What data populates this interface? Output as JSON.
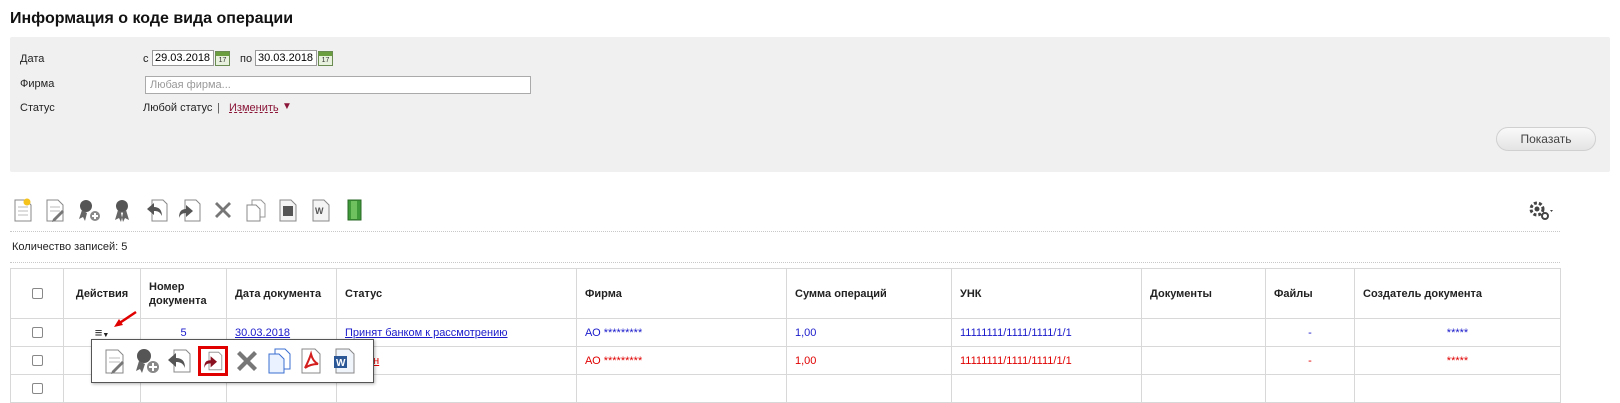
{
  "page": {
    "title": "Информация о коде вида операции"
  },
  "filters": {
    "date_label": "Дата",
    "date_from_prefix": "с",
    "date_from": "29.03.2018",
    "date_to_prefix": "по",
    "date_to": "30.03.2018",
    "firm_label": "Фирма",
    "firm_placeholder": "Любая фирма...",
    "status_label": "Статус",
    "status_value": "Любой статус",
    "status_separator": "|",
    "status_change": "Изменить",
    "show_button": "Показать"
  },
  "toolbar": {
    "icons": [
      "new-document-icon",
      "edit-document-icon",
      "add-signature-icon",
      "signature-icon",
      "send-icon",
      "recall-icon",
      "delete-icon",
      "copy-icon",
      "print-icon",
      "word-export-icon",
      "exit-icon"
    ],
    "settings_icon": "gear-icon"
  },
  "records": {
    "count_text": "Количество записей: 5"
  },
  "table": {
    "headers": {
      "actions": "Действия",
      "doc_number": "Номер документа",
      "doc_date": "Дата документа",
      "status": "Статус",
      "firm": "Фирма",
      "amount": "Сумма операций",
      "unk": "УНК",
      "documents": "Документы",
      "files": "Файлы",
      "creator": "Создатель документа"
    },
    "rows": [
      {
        "number": "5",
        "date": "30.03.2018",
        "status": "Принят банком к рассмотрению",
        "firm": "АО *********",
        "amount": "1,00",
        "unk": "11111111/1111/1111/1/1",
        "documents": "",
        "files": "-",
        "creator": "*****",
        "color": "#1a1acb"
      },
      {
        "number": "",
        "date": "",
        "status": "ен",
        "firm": "АО *********",
        "amount": "1,00",
        "unk": "11111111/1111/1111/1/1",
        "documents": "",
        "files": "-",
        "creator": "*****",
        "color": "#e00000"
      }
    ]
  },
  "popup": {
    "icons": [
      "edit-document-icon",
      "add-signature-icon",
      "send-icon",
      "recall-icon",
      "delete-icon",
      "copy-icon",
      "pdf-icon",
      "word-icon"
    ],
    "active_icon": "recall-icon"
  },
  "colors": {
    "accent_link": "#1a1acb",
    "danger": "#e00000",
    "change_link": "#8a1538"
  }
}
